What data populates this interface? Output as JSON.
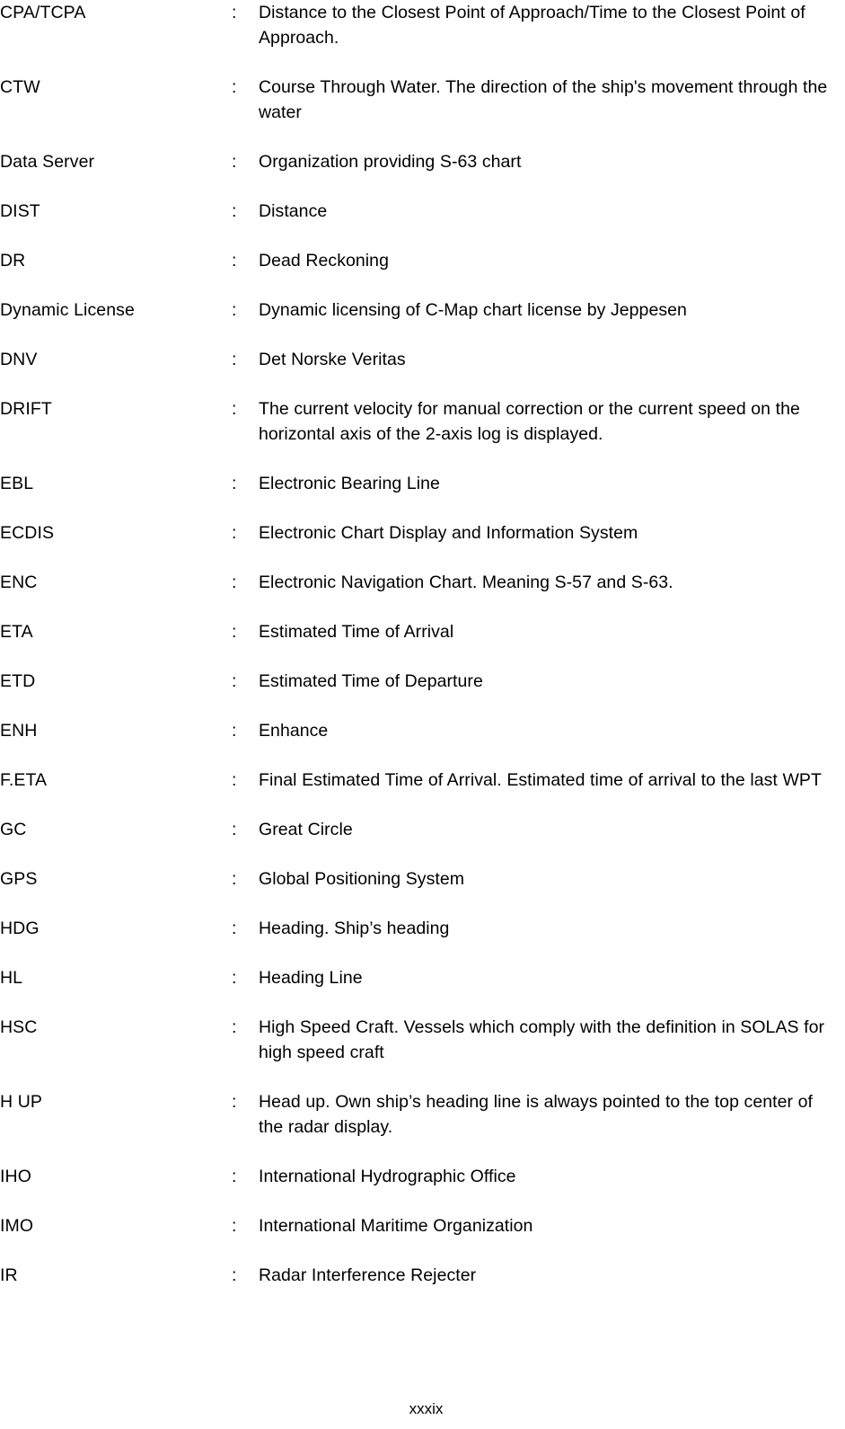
{
  "document": {
    "page_number": "xxxix",
    "separator": ":"
  },
  "glossary": {
    "entries": [
      {
        "term": "CPA/TCPA",
        "definition": "Distance to the Closest Point of Approach/Time to the Closest Point of Approach."
      },
      {
        "term": "CTW",
        "definition": "Course Through Water. The direction of the ship's movement through the water"
      },
      {
        "term": "Data Server",
        "definition": "Organization providing S-63 chart"
      },
      {
        "term": "DIST",
        "definition": "Distance"
      },
      {
        "term": "DR",
        "definition": "Dead Reckoning"
      },
      {
        "term": "Dynamic License",
        "definition": "Dynamic licensing of C-Map chart license by Jeppesen"
      },
      {
        "term": "DNV",
        "definition": "Det Norske Veritas"
      },
      {
        "term": "DRIFT",
        "definition": "The current velocity for manual correction or the current speed on the horizontal axis of the 2-axis log is displayed."
      },
      {
        "term": "EBL",
        "definition": "Electronic Bearing Line"
      },
      {
        "term": "ECDIS",
        "definition": "Electronic Chart Display and Information System"
      },
      {
        "term": "ENC",
        "definition": "Electronic Navigation Chart. Meaning S-57 and S-63."
      },
      {
        "term": "ETA",
        "definition": "Estimated Time of Arrival"
      },
      {
        "term": "ETD",
        "definition": "Estimated Time of Departure"
      },
      {
        "term": "ENH",
        "definition": "Enhance"
      },
      {
        "term": "F.ETA",
        "definition": "Final Estimated Time of Arrival. Estimated time of arrival to the last WPT"
      },
      {
        "term": "GC",
        "definition": "Great Circle"
      },
      {
        "term": "GPS",
        "definition": "Global Positioning System"
      },
      {
        "term": "HDG",
        "definition": "Heading. Ship’s heading"
      },
      {
        "term": "HL",
        "definition": "Heading Line"
      },
      {
        "term": "HSC",
        "definition": "High Speed Craft. Vessels which comply with the definition in SOLAS for high speed craft"
      },
      {
        "term": "H UP",
        "definition": "Head up. Own ship’s heading line is always pointed to the top center of the radar display."
      },
      {
        "term": "IHO",
        "definition": "International Hydrographic Office"
      },
      {
        "term": "IMO",
        "definition": "International Maritime Organization"
      },
      {
        "term": "IR",
        "definition": "Radar Interference Rejecter"
      }
    ]
  }
}
